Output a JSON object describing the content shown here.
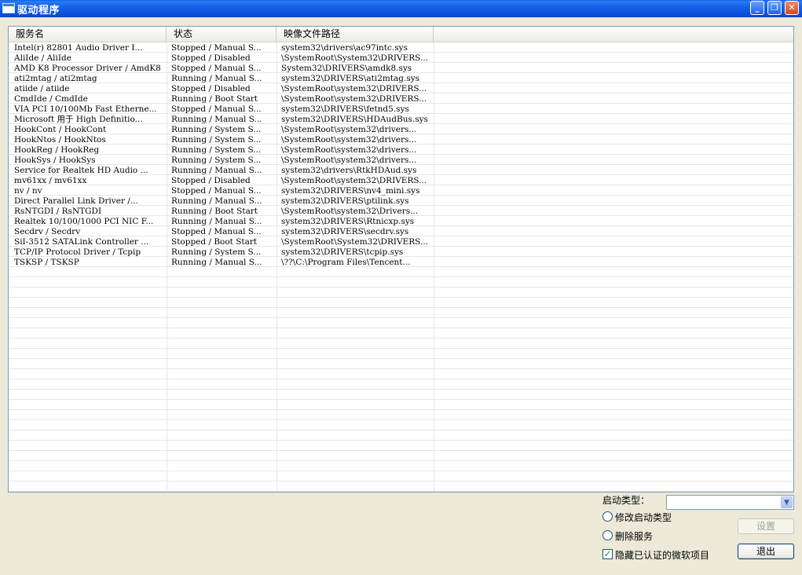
{
  "window": {
    "title": "驱动程序",
    "controls": {
      "minimize": "_",
      "maximize": "❐",
      "close": "✕"
    }
  },
  "columns": [
    "服务名",
    "状态",
    "映像文件路径"
  ],
  "rows": [
    [
      "Intel(r) 82801 Audio Driver I...",
      "Stopped / Manual S...",
      "system32\\drivers\\ac97intc.sys"
    ],
    [
      "AliIde / AliIde",
      "Stopped / Disabled",
      "\\SystemRoot\\System32\\DRIVERS..."
    ],
    [
      "AMD K8 Processor Driver / AmdK8",
      "Stopped / Manual S...",
      "System32\\DRIVERS\\amdk8.sys"
    ],
    [
      "ati2mtag / ati2mtag",
      "Running / Manual S...",
      "system32\\DRIVERS\\ati2mtag.sys"
    ],
    [
      "atiide / atiide",
      "Stopped / Disabled",
      "\\SystemRoot\\system32\\DRIVERS..."
    ],
    [
      "CmdIde / CmdIde",
      "Running / Boot Start",
      "\\SystemRoot\\system32\\DRIVERS..."
    ],
    [
      "VIA PCI 10/100Mb Fast Etherne...",
      "Stopped / Manual S...",
      "system32\\DRIVERS\\fetnd5.sys"
    ],
    [
      "Microsoft 用于 High Definitio...",
      "Running / Manual S...",
      "system32\\DRIVERS\\HDAudBus.sys"
    ],
    [
      "HookCont / HookCont",
      "Running / System S...",
      "\\SystemRoot\\system32\\drivers..."
    ],
    [
      "HookNtos / HookNtos",
      "Running / System S...",
      "\\SystemRoot\\system32\\drivers..."
    ],
    [
      "HookReg / HookReg",
      "Running / System S...",
      "\\SystemRoot\\system32\\drivers..."
    ],
    [
      "HookSys / HookSys",
      "Running / System S...",
      "\\SystemRoot\\system32\\drivers..."
    ],
    [
      "Service for Realtek HD Audio ...",
      "Running / Manual S...",
      "system32\\drivers\\RtkHDAud.sys"
    ],
    [
      "mv61xx / mv61xx",
      "Stopped / Disabled",
      "\\SystemRoot\\system32\\DRIVERS..."
    ],
    [
      "nv / nv",
      "Stopped / Manual S...",
      "system32\\DRIVERS\\nv4_mini.sys"
    ],
    [
      "Direct Parallel Link Driver /...",
      "Running / Manual S...",
      "system32\\DRIVERS\\ptilink.sys"
    ],
    [
      "RsNTGDI / RsNTGDI",
      "Running / Boot Start",
      "\\SystemRoot\\system32\\Drivers..."
    ],
    [
      "Realtek 10/100/1000 PCI NIC F...",
      "Running / Manual S...",
      "system32\\DRIVERS\\Rtnicxp.sys"
    ],
    [
      "Secdrv / Secdrv",
      "Stopped / Manual S...",
      "system32\\DRIVERS\\secdrv.sys"
    ],
    [
      "SiI-3512 SATALink Controller ...",
      "Stopped / Boot Start",
      "\\SystemRoot\\System32\\DRIVERS..."
    ],
    [
      "TCP/IP Protocol Driver / Tcpip",
      "Running / System S...",
      "system32\\DRIVERS\\tcpip.sys"
    ],
    [
      "TSKSP / TSKSP",
      "Running / Manual S...",
      "\\??\\C:\\Program Files\\Tencent..."
    ]
  ],
  "controls": {
    "startup_type_label": "启动类型：",
    "startup_type_value": "",
    "modify_startup_label": "修改启动类型",
    "delete_service_label": "删除服务",
    "hide_ms_label": "隐藏已认证的微软项目",
    "hide_ms_checked": true,
    "set_button": "设置",
    "exit_button": "退出"
  },
  "icons": {
    "app": "window-icon",
    "combo_arrow": "chevron-down-icon",
    "check": "checkmark-icon"
  }
}
